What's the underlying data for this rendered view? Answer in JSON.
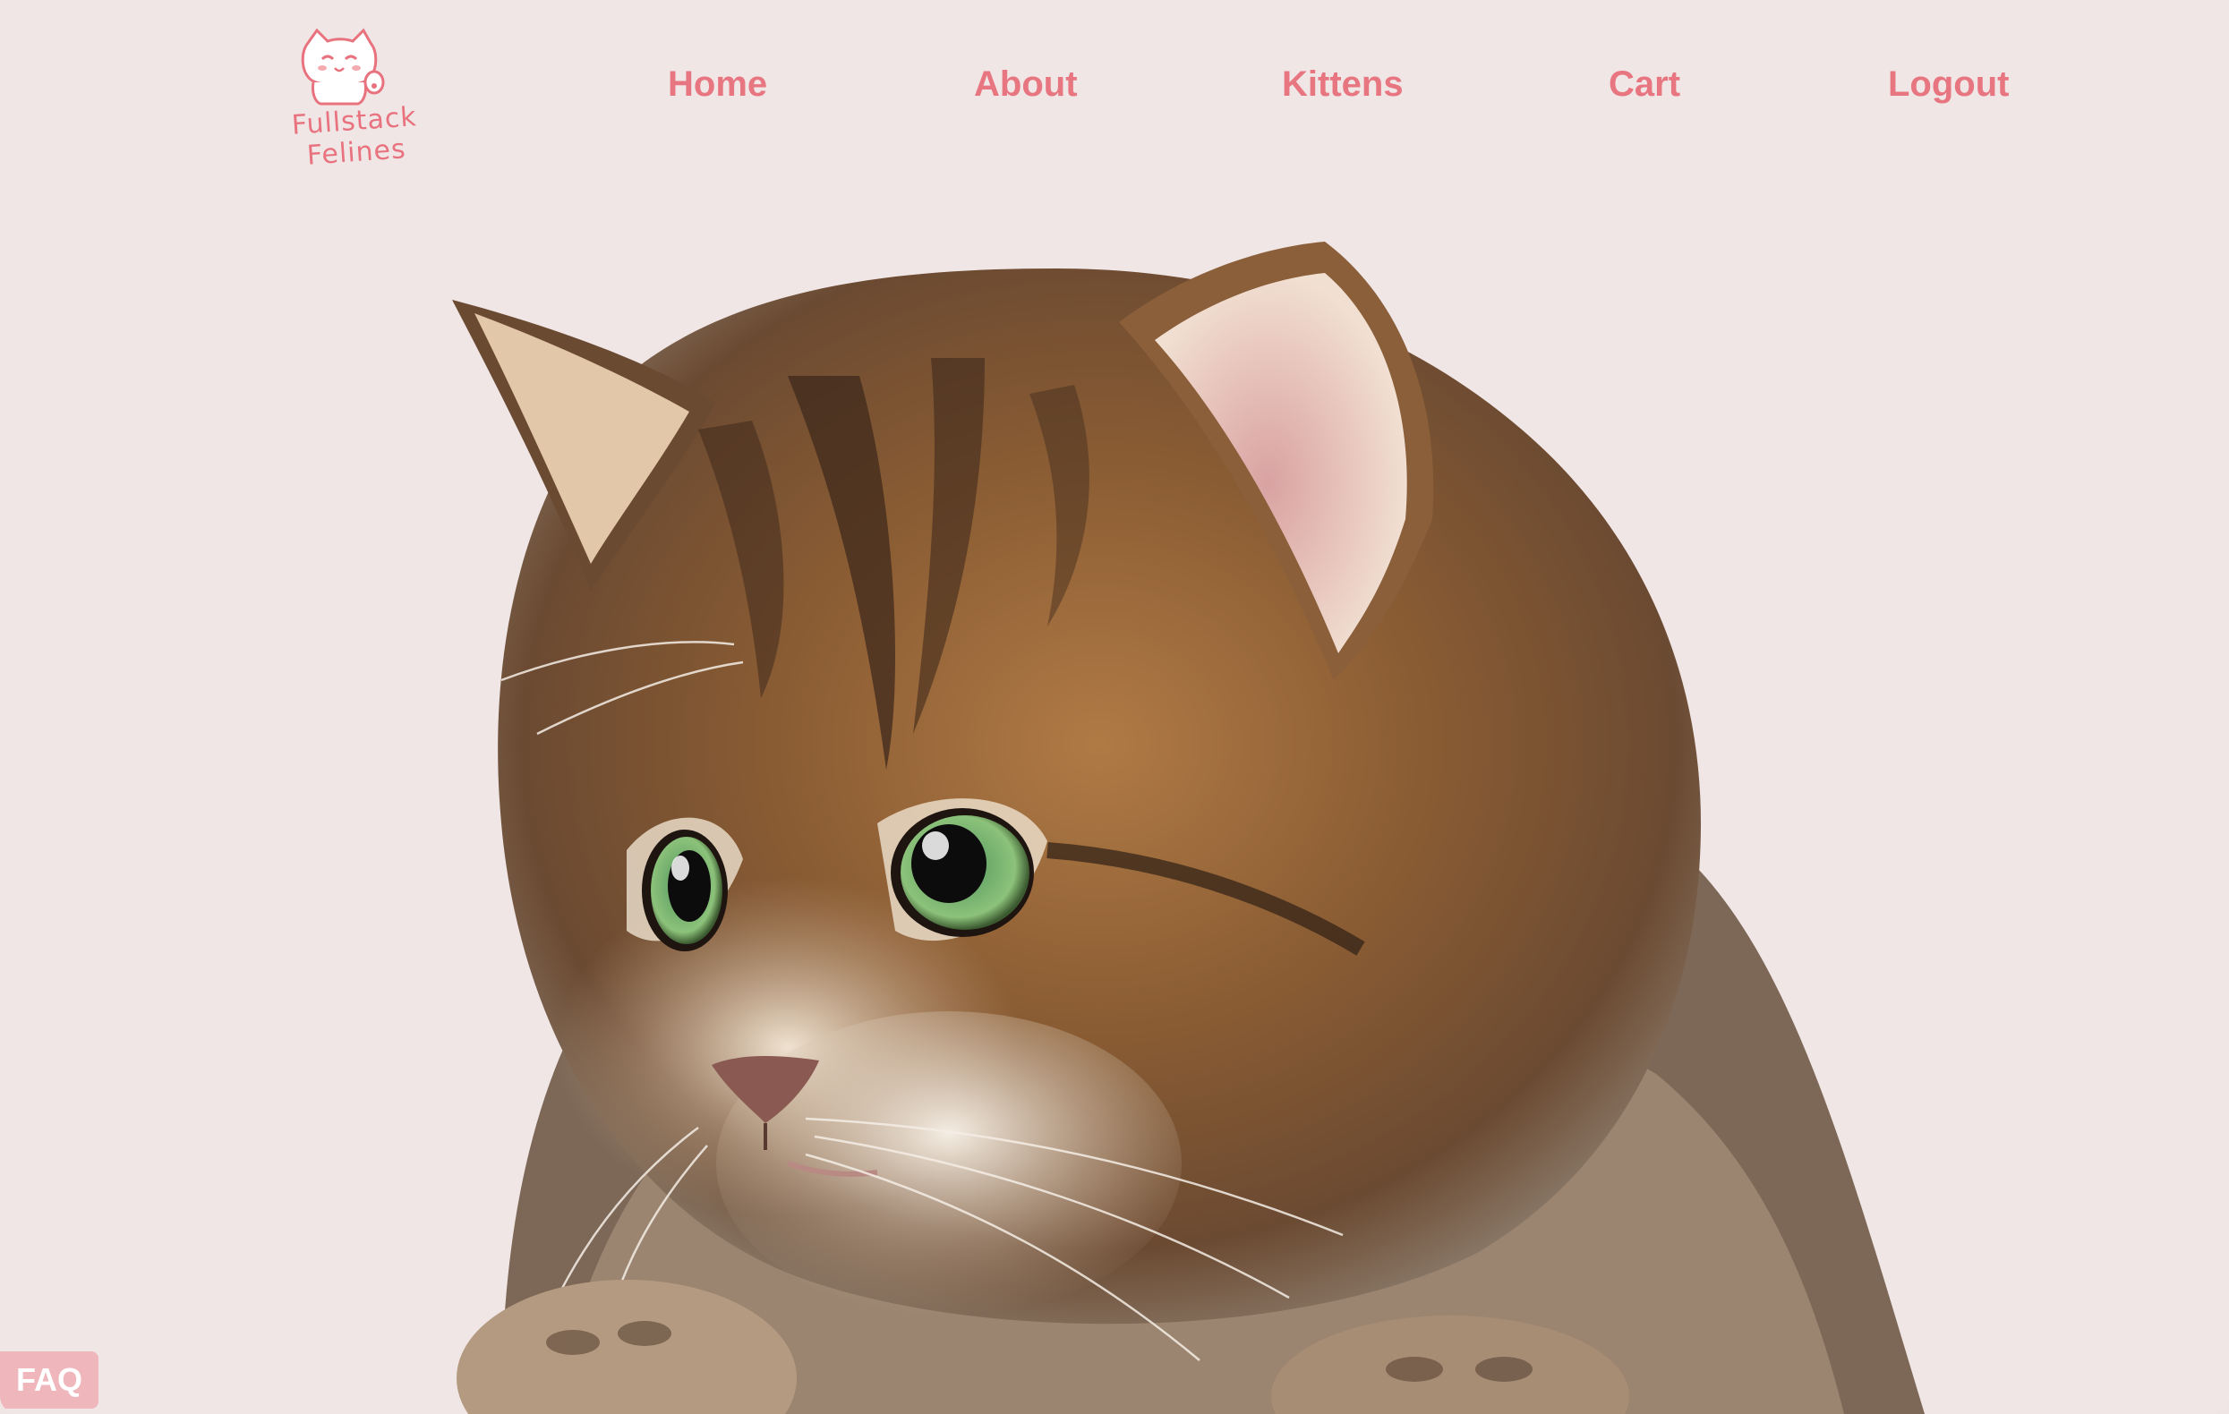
{
  "brand": {
    "name": "Fullstack Felines",
    "accent_color": "#e8727e",
    "logo_icon": "cat-waving-icon"
  },
  "nav": {
    "items": [
      {
        "label": "Home"
      },
      {
        "label": "About"
      },
      {
        "label": "Kittens"
      },
      {
        "label": "Cart"
      },
      {
        "label": "Logout"
      }
    ]
  },
  "hero": {
    "image": "kitten-portrait-image"
  },
  "faq": {
    "label": "FAQ",
    "color": "#efb7bc"
  },
  "colors": {
    "background": "#f0e6e6",
    "nav_text": "#e77681"
  }
}
